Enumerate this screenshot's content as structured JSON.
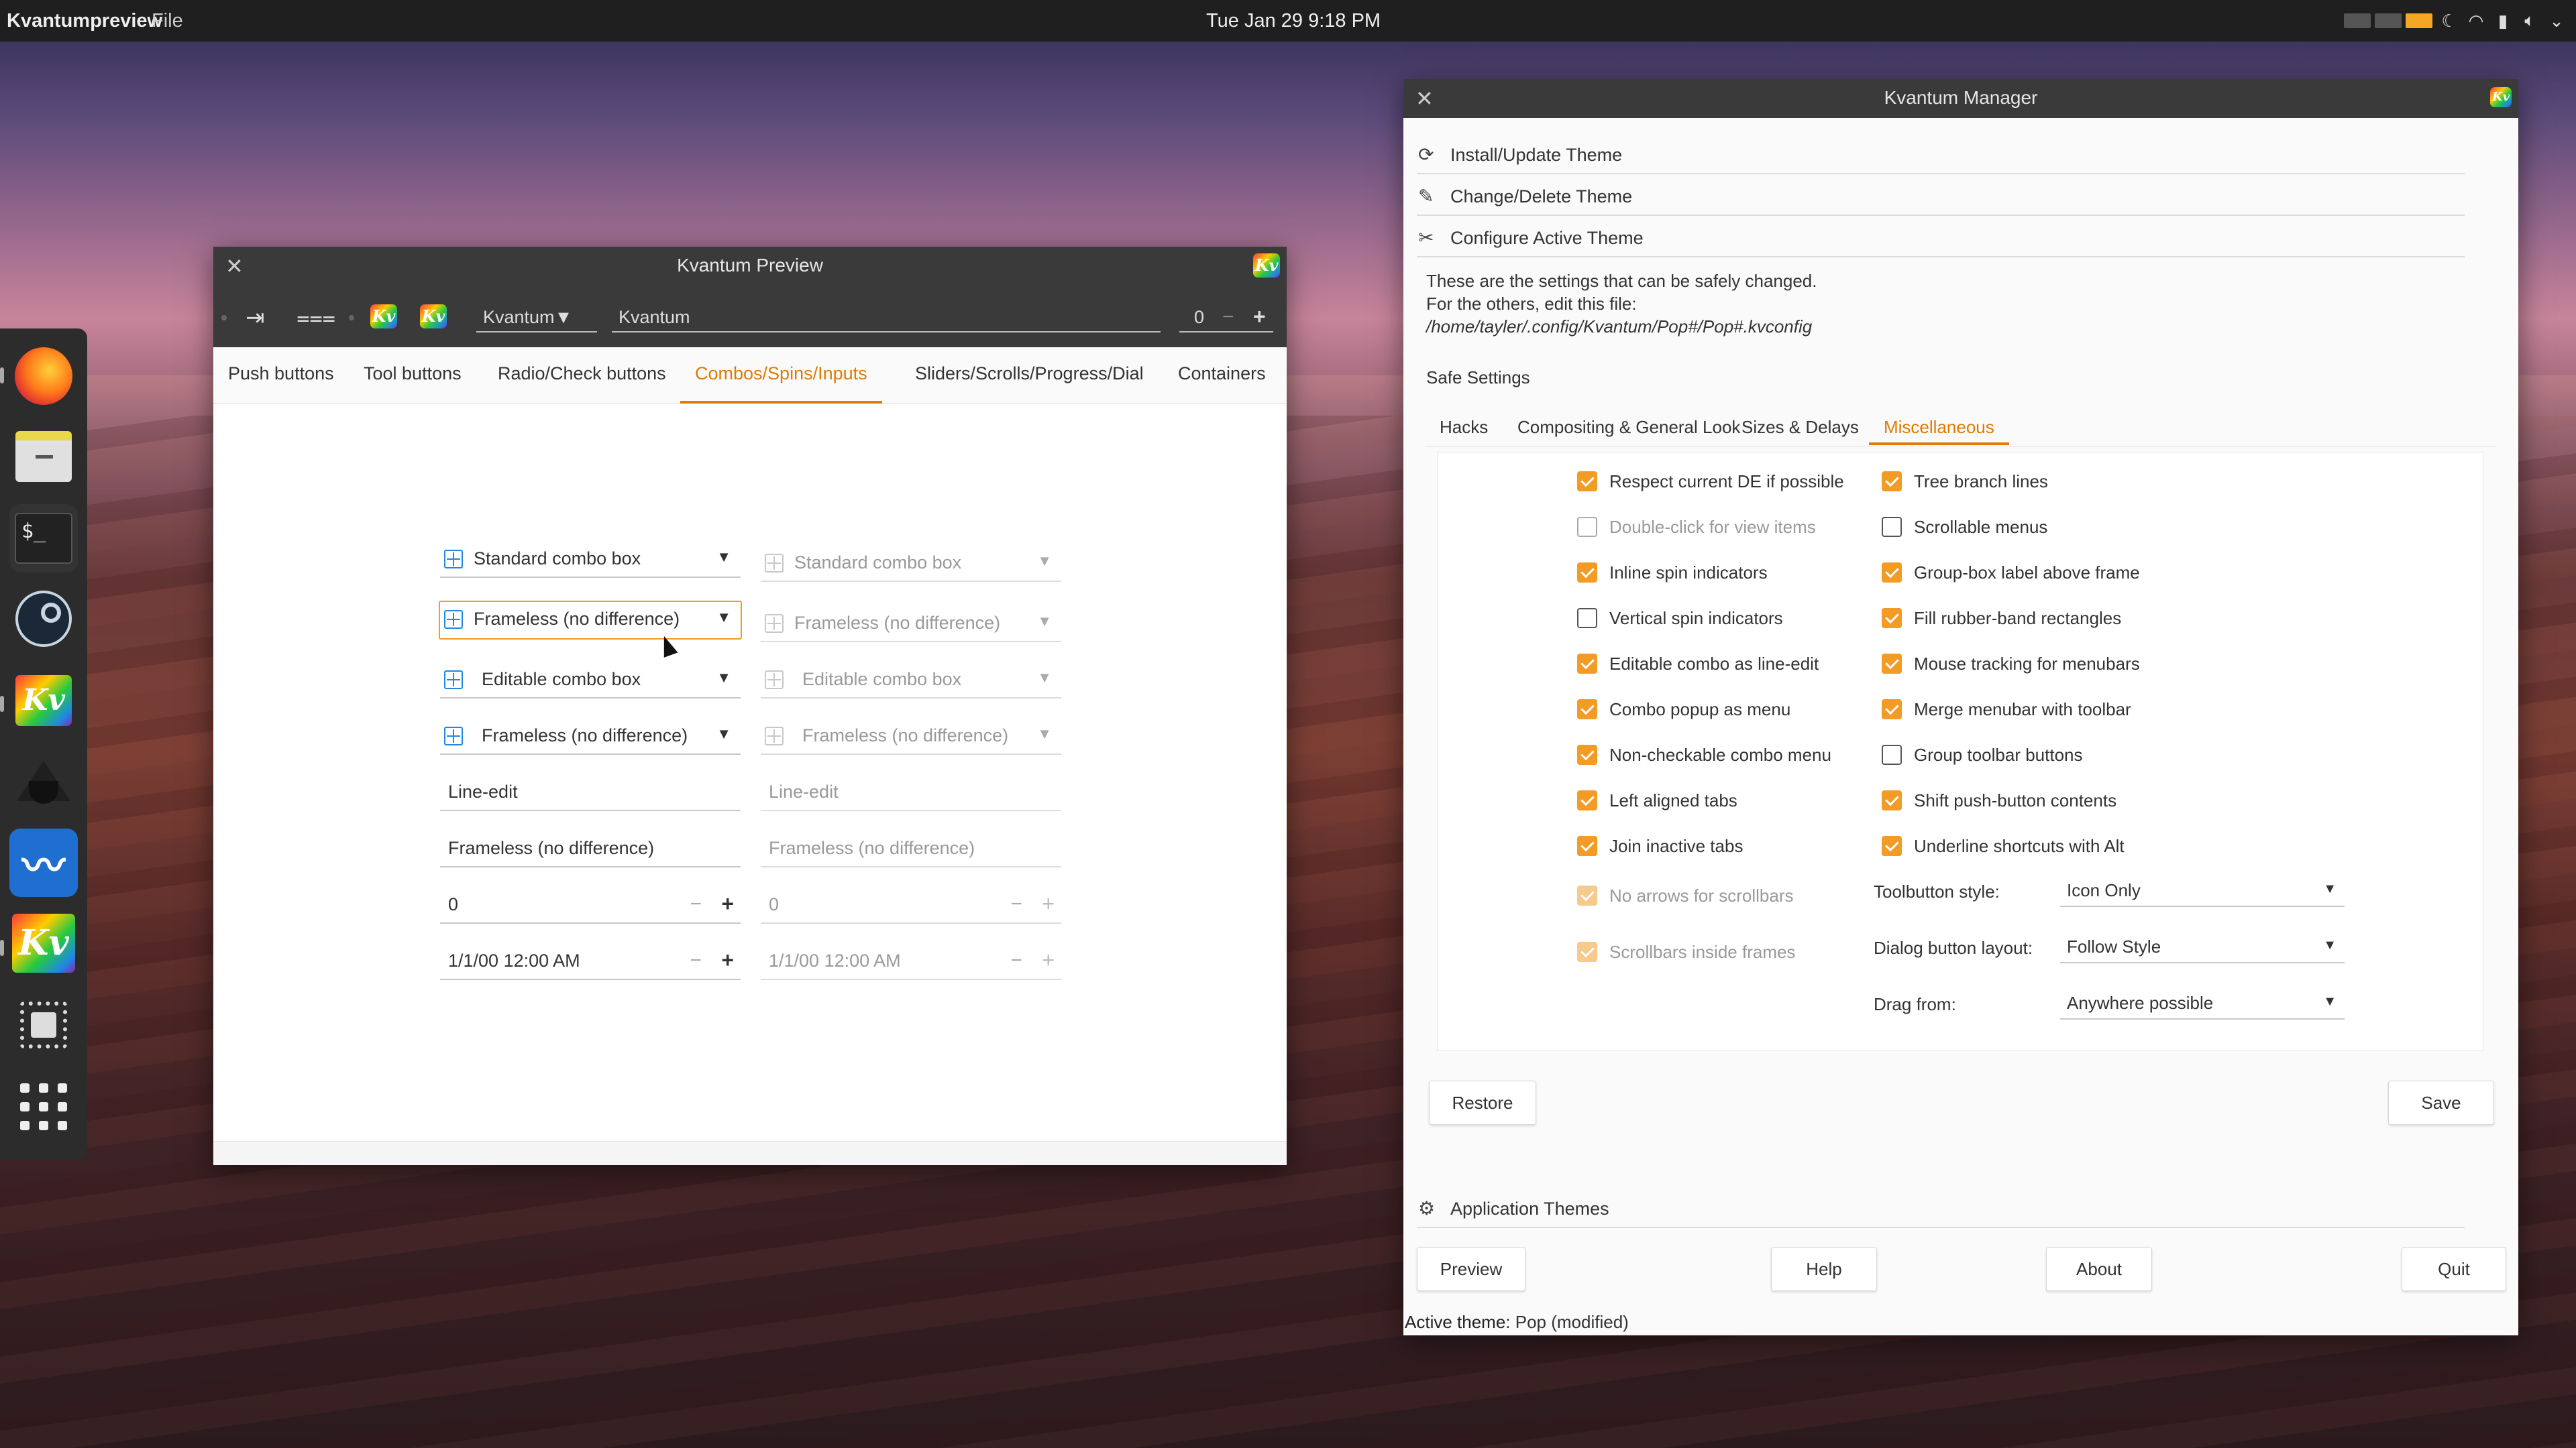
{
  "topbar": {
    "app_name": "Kvantumpreview",
    "file_menu": "File",
    "clock": "Tue Jan 29  9:18 PM",
    "accent": "#f5a623"
  },
  "dock": {
    "items": [
      {
        "name": "firefox-icon"
      },
      {
        "name": "files-icon"
      },
      {
        "name": "terminal-icon",
        "label": "$_"
      },
      {
        "name": "steam-icon"
      },
      {
        "name": "kvantum-icon",
        "label": "Kv"
      },
      {
        "name": "inkscape-icon"
      },
      {
        "name": "sound-editor-icon"
      },
      {
        "name": "kvantum-manager-icon",
        "label": "Kv"
      },
      {
        "name": "cpu-monitor-icon"
      },
      {
        "name": "app-grid-icon"
      }
    ]
  },
  "preview": {
    "title": "Kvantum Preview",
    "logo_text": "Kv",
    "toolbar": {
      "combo_value": "Kvantum",
      "line_value": "Kvantum",
      "spin_value": "0",
      "spin_minus": "−",
      "spin_plus": "+"
    },
    "tabs": [
      {
        "label": "Push buttons"
      },
      {
        "label": "Tool buttons"
      },
      {
        "label": "Radio/Check buttons"
      },
      {
        "label": "Combos/Spins/Inputs"
      },
      {
        "label": "Sliders/Scrolls/Progress/Dial"
      },
      {
        "label": "Containers"
      }
    ],
    "active_tab": "Combos/Spins/Inputs",
    "fields": {
      "std_combo": "Standard combo box",
      "std_combo_dis": "Standard combo box",
      "frameless1": "Frameless (no difference)",
      "frameless1_dis": "Frameless (no difference)",
      "editable": "Editable combo box",
      "editable_dis": "Editable combo box",
      "frameless2": "Frameless (no difference)",
      "frameless2_dis": "Frameless (no difference)",
      "lineedit": "Line-edit",
      "lineedit_dis": "Line-edit",
      "frameless3": "Frameless (no difference)",
      "frameless3_dis": "Frameless (no difference)",
      "spin": "0",
      "spin_dis": "0",
      "datetime": "1/1/00 12:00 AM",
      "datetime_dis": "1/1/00 12:00 AM",
      "minus": "−",
      "plus": "+"
    }
  },
  "manager": {
    "title": "Kvantum Manager",
    "logo_text": "Kv",
    "sections": {
      "install": "Install/Update Theme",
      "change": "Change/Delete Theme",
      "configure": "Configure Active Theme",
      "app_themes": "Application Themes"
    },
    "info": {
      "line1": "These are the settings that can be safely changed.",
      "line2": "For the others, edit this file:",
      "path": "/home/tayler/.config/Kvantum/Pop#/Pop#.kvconfig"
    },
    "safe_settings": "Safe Settings",
    "tabs": [
      {
        "label": "Hacks"
      },
      {
        "label": "Compositing & General Look"
      },
      {
        "label": "Sizes & Delays"
      },
      {
        "label": "Miscellaneous"
      }
    ],
    "active_tab": "Miscellaneous",
    "left_checks": [
      {
        "label": "Respect current DE if possible",
        "checked": true
      },
      {
        "label": "Double-click for view items",
        "checked": false,
        "disabled": true
      },
      {
        "label": "Inline spin indicators",
        "checked": true
      },
      {
        "label": "Vertical spin indicators",
        "checked": false
      },
      {
        "label": "Editable combo as line-edit",
        "checked": true
      },
      {
        "label": "Combo popup as menu",
        "checked": true
      },
      {
        "label": "Non-checkable combo menu",
        "checked": true
      },
      {
        "label": "Left aligned tabs",
        "checked": true
      },
      {
        "label": "Join inactive tabs",
        "checked": true
      },
      {
        "label": "No arrows for scrollbars",
        "checked": true,
        "disabled": true
      },
      {
        "label": "Scrollbars inside frames",
        "checked": true,
        "disabled": true
      }
    ],
    "right_checks": [
      {
        "label": "Tree branch lines",
        "checked": true
      },
      {
        "label": "Scrollable menus",
        "checked": false
      },
      {
        "label": "Group-box label above frame",
        "checked": true
      },
      {
        "label": "Fill rubber-band rectangles",
        "checked": true
      },
      {
        "label": "Mouse tracking for menubars",
        "checked": true
      },
      {
        "label": "Merge menubar with toolbar",
        "checked": true
      },
      {
        "label": "Group toolbar buttons",
        "checked": false
      },
      {
        "label": "Shift push-button contents",
        "checked": true
      },
      {
        "label": "Underline shortcuts with Alt",
        "checked": true
      }
    ],
    "selects": {
      "toolbutton_label": "Toolbutton style:",
      "toolbutton_value": "Icon Only",
      "dialog_label": "Dialog button layout:",
      "dialog_value": "Follow Style",
      "drag_label": "Drag from:",
      "drag_value": "Anywhere possible"
    },
    "buttons": {
      "restore": "Restore",
      "save": "Save",
      "preview": "Preview",
      "help": "Help",
      "about": "About",
      "quit": "Quit"
    },
    "status_label": "Active theme:",
    "status_value": "Pop (modified)",
    "accent": "#f29b25"
  }
}
